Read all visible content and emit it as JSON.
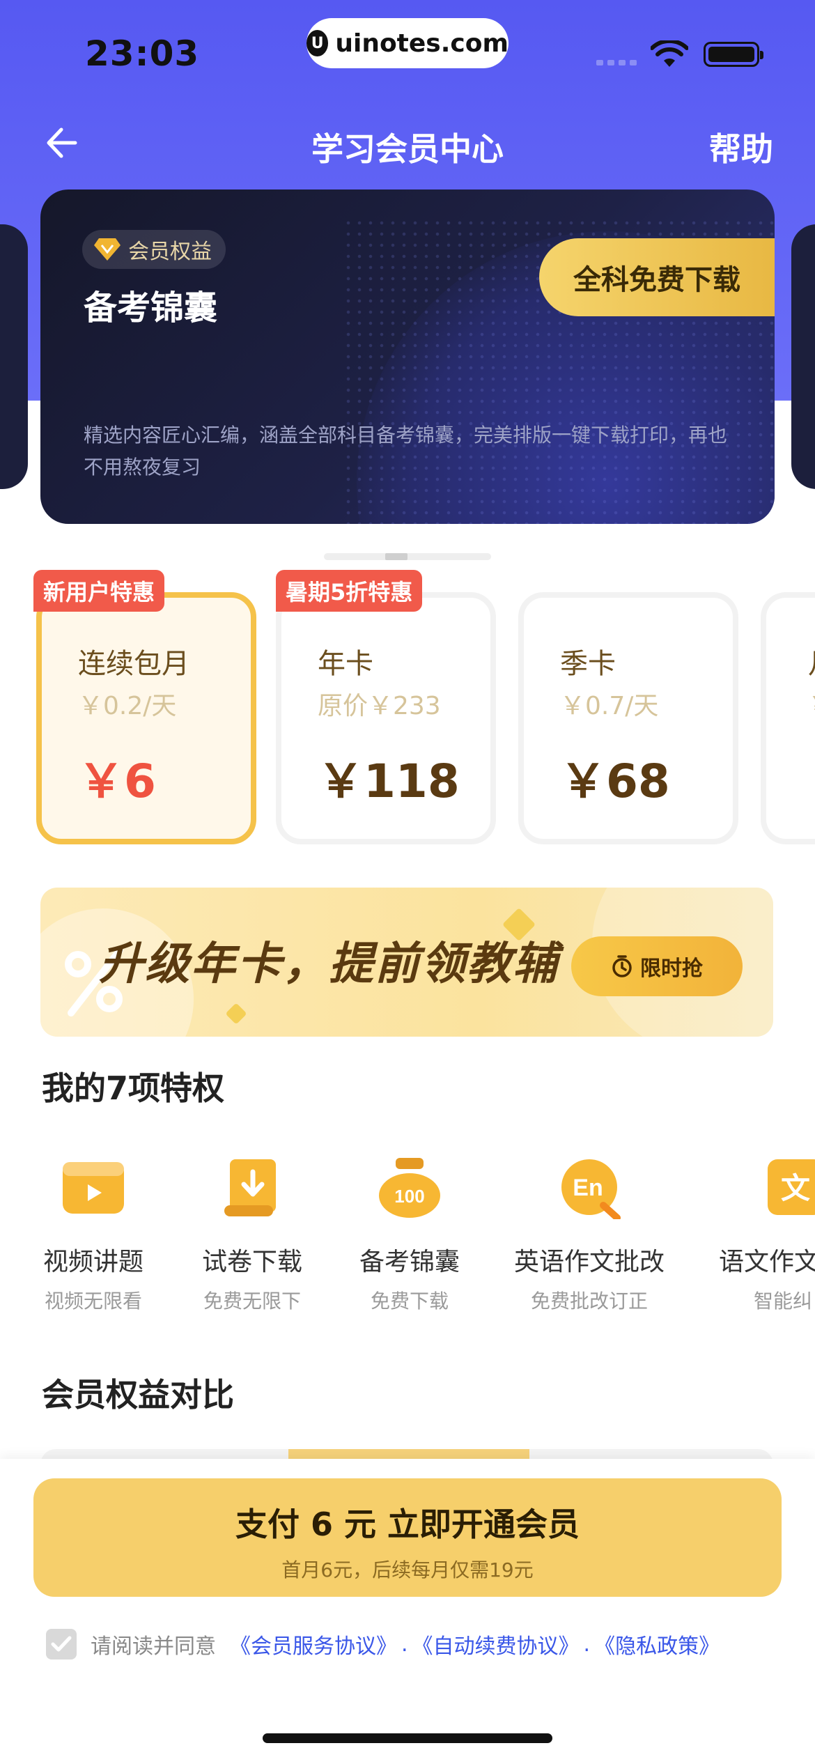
{
  "status_bar": {
    "time": "23:03",
    "url": "uinotes.com"
  },
  "nav": {
    "title": "学习会员中心",
    "help": "帮助"
  },
  "banner": {
    "badge": "会员权益",
    "title": "备考锦囊",
    "button": "全科免费下载",
    "desc": "精选内容匠心汇编，涵盖全部科目备考锦囊，完美排版一键下载打印，再也不用熬夜复习"
  },
  "plans": [
    {
      "tag": "新用户特惠",
      "name": "连续包月",
      "sub": "￥0.2/天",
      "price": "￥6"
    },
    {
      "tag": "暑期5折特惠",
      "name": "年卡",
      "sub": "原价￥233",
      "price": "￥118"
    },
    {
      "tag": "",
      "name": "季卡",
      "sub": "￥0.7/天",
      "price": "￥68"
    },
    {
      "tag": "",
      "name": "月",
      "sub": "￥",
      "price": "￥"
    }
  ],
  "promo": {
    "text": "升级年卡，提前领教辅",
    "button": "限时抢"
  },
  "privileges": {
    "title": "我的7项特权",
    "items": [
      {
        "title": "视频讲题",
        "sub": "视频无限看"
      },
      {
        "title": "试卷下载",
        "sub": "免费无限下"
      },
      {
        "title": "备考锦囊",
        "sub": "免费下载"
      },
      {
        "title": "英语作文批改",
        "sub": "免费批改订正"
      },
      {
        "title": "语文作文",
        "sub": "智能纠"
      }
    ]
  },
  "compare": {
    "title": "会员权益对比"
  },
  "pay": {
    "main": "支付 6 元 立即开通会员",
    "sub": "首月6元，后续每月仅需19元"
  },
  "agreement": {
    "prefix": "请阅读并同意",
    "link1": "《会员服务协议》",
    "link2": "《自动续费协议》",
    "link3": "《隐私政策》",
    "sep": "."
  },
  "icons": {
    "coin_label": "100",
    "en_label": "En",
    "wen_label": "文"
  },
  "colors": {
    "primary": "#5659f2",
    "gold": "#f6cf6b",
    "red": "#f15a4a",
    "link": "#3a57e8"
  }
}
